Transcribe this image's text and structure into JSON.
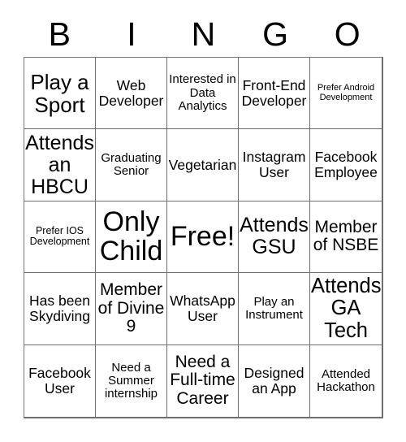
{
  "card": {
    "header_letters": [
      "B",
      "I",
      "N",
      "G",
      "O"
    ],
    "columns": 5,
    "rows": 5,
    "free_space_text": "Free!",
    "free_space_position": "center",
    "colors": {
      "background": "#ffffff",
      "text": "#000000",
      "grid_line": "#6e6e6e"
    },
    "cells": [
      {
        "text": "Play a Sport",
        "size": "xl",
        "free": false
      },
      {
        "text": "Web Developer",
        "size": "md",
        "free": false
      },
      {
        "text": "Interested in Data Analytics",
        "size": "sm",
        "free": false
      },
      {
        "text": "Front-End Developer",
        "size": "md",
        "free": false
      },
      {
        "text": "Prefer Android Development",
        "size": "xxs",
        "free": false
      },
      {
        "text": "Attends an HBCU",
        "size": "xl",
        "free": false
      },
      {
        "text": "Graduating Senior",
        "size": "sm",
        "free": false
      },
      {
        "text": "Vegetarian",
        "size": "md",
        "free": false
      },
      {
        "text": "Instagram User",
        "size": "md",
        "free": false
      },
      {
        "text": "Facebook Employee",
        "size": "md",
        "free": false
      },
      {
        "text": "Prefer IOS Development",
        "size": "xs",
        "free": false
      },
      {
        "text": "Only Child",
        "size": "xxl",
        "free": false
      },
      {
        "text": "Free!",
        "size": "xxl",
        "free": true
      },
      {
        "text": "Attends GSU",
        "size": "xl",
        "free": false
      },
      {
        "text": "Member of NSBE",
        "size": "lg",
        "free": false
      },
      {
        "text": "Has been Skydiving",
        "size": "md",
        "free": false
      },
      {
        "text": "Member of Divine 9",
        "size": "lg",
        "free": false
      },
      {
        "text": "WhatsApp User",
        "size": "md",
        "free": false
      },
      {
        "text": "Play an Instrument",
        "size": "sm",
        "free": false
      },
      {
        "text": "Attends GA Tech",
        "size": "xl",
        "free": false
      },
      {
        "text": "Facebook User",
        "size": "md",
        "free": false
      },
      {
        "text": "Need a Summer internship",
        "size": "sm",
        "free": false
      },
      {
        "text": "Need a Full-time Career",
        "size": "lg",
        "free": false
      },
      {
        "text": "Designed an App",
        "size": "md",
        "free": false
      },
      {
        "text": "Attended Hackathon",
        "size": "sm",
        "free": false
      }
    ]
  }
}
